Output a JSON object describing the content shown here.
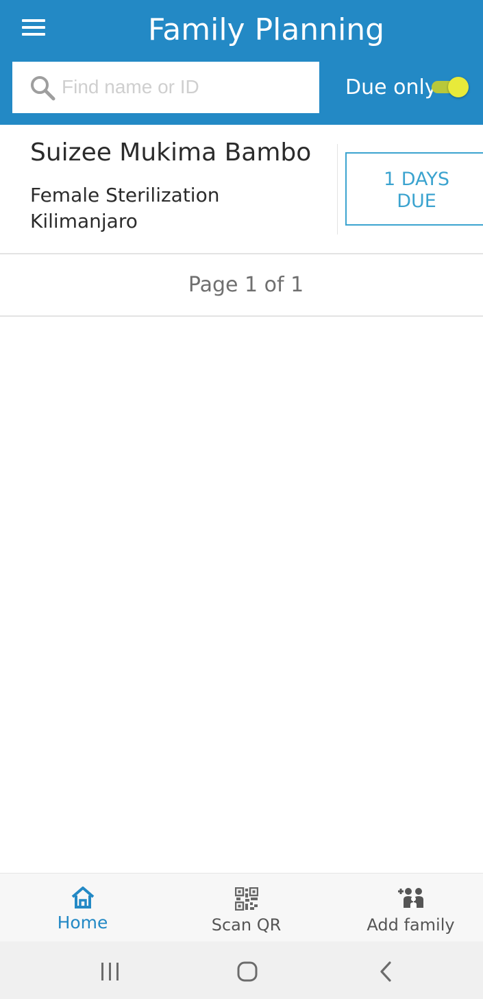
{
  "appbar": {
    "title": "Family Planning",
    "menu_icon": "hamburger-menu-icon",
    "background_color": "#2389c5"
  },
  "search": {
    "placeholder": "Find name or ID",
    "value": "",
    "icon": "search-icon"
  },
  "filter": {
    "label": "Due only",
    "enabled": true,
    "toggle_color": "#e8ea3a"
  },
  "clients": [
    {
      "name": "Suizee Mukima Bambo…",
      "method": "Female Sterilization",
      "location": "Kilimanjaro",
      "due_line1": "1 DAYS",
      "due_line2": "DUE",
      "due_color": "#3ba3cf"
    }
  ],
  "pager": {
    "text": "Page 1 of 1"
  },
  "bottom_nav": {
    "items": [
      {
        "label": "Home",
        "icon": "home-icon",
        "active": true
      },
      {
        "label": "Scan QR",
        "icon": "qr-code-icon",
        "active": false
      },
      {
        "label": "Add family",
        "icon": "add-family-icon",
        "active": false
      }
    ],
    "active_color": "#2389c5",
    "inactive_color": "#555555"
  },
  "system_nav": {
    "buttons": [
      "recent-apps-icon",
      "home-circle-icon",
      "back-chevron-icon"
    ]
  }
}
